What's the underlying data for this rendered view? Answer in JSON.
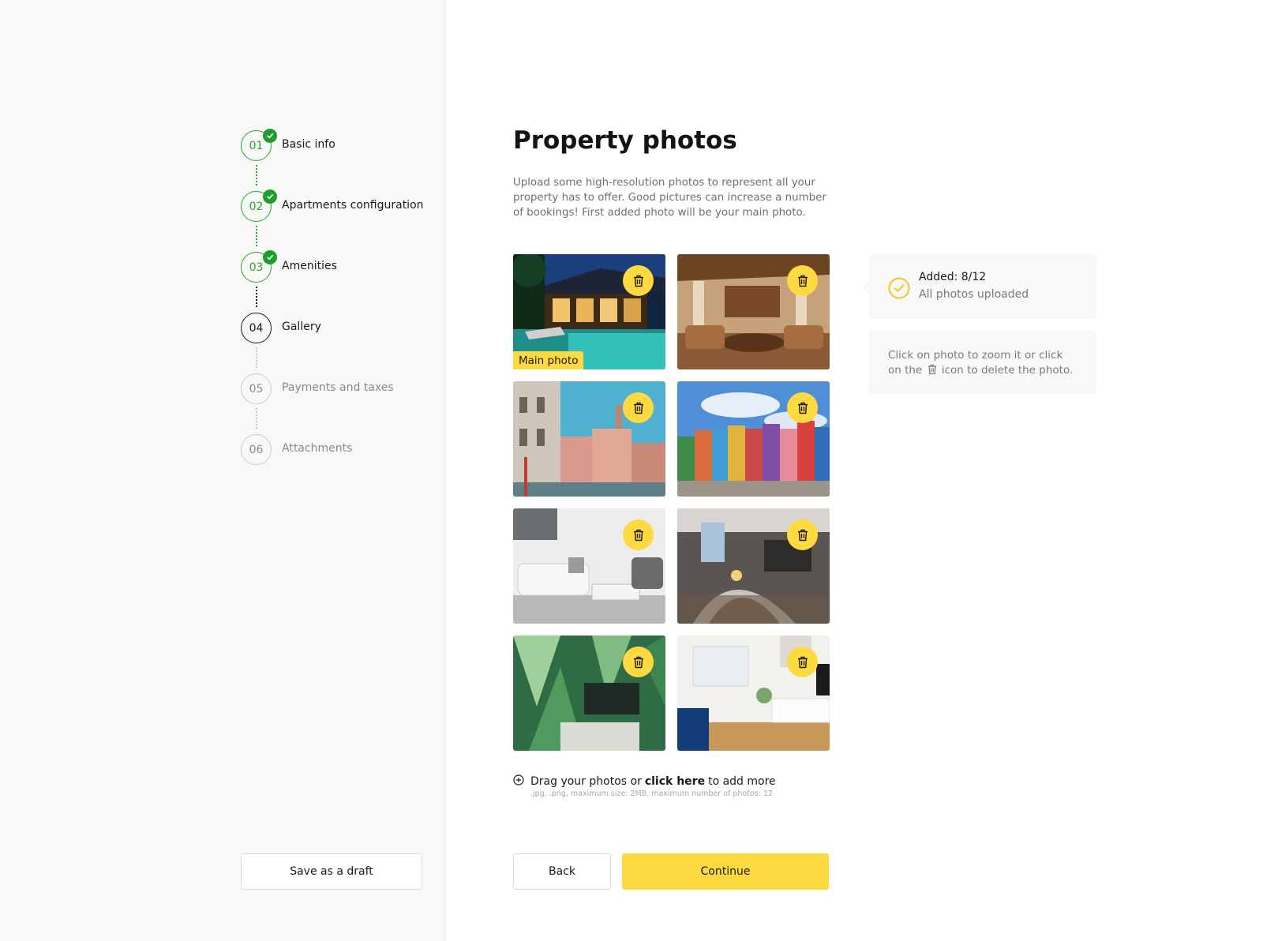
{
  "steps": [
    {
      "number": "01",
      "label": "Basic info",
      "state": "done"
    },
    {
      "number": "02",
      "label": "Apartments configuration",
      "state": "done"
    },
    {
      "number": "03",
      "label": "Amenities",
      "state": "done"
    },
    {
      "number": "04",
      "label": "Gallery",
      "state": "current"
    },
    {
      "number": "05",
      "label": "Payments and taxes",
      "state": "pending"
    },
    {
      "number": "06",
      "label": "Attachments",
      "state": "pending"
    }
  ],
  "sidebar": {
    "draft_label": "Save as a draft"
  },
  "page": {
    "title": "Property photos",
    "description": "Upload some high-resolution photos to represent all your property has to offer. Good pictures can increase a number of bookings! First added photo will be your main photo."
  },
  "photos": {
    "main_tag": "Main photo",
    "items": [
      {
        "subject": "villa with pool at night"
      },
      {
        "subject": "wood-paneled living room"
      },
      {
        "subject": "pink venetian facades"
      },
      {
        "subject": "colorful market square houses"
      },
      {
        "subject": "white sofa living room"
      },
      {
        "subject": "loft with staircase"
      },
      {
        "subject": "tropical leaf wallpaper room"
      },
      {
        "subject": "bright room with blue sofa"
      }
    ]
  },
  "status": {
    "added_label": "Added: 8/12",
    "uploaded_label": "All photos uploaded"
  },
  "hint": {
    "before_icon": "Click on photo to zoom it or click on the",
    "after_icon": "icon to delete the photo."
  },
  "uploader": {
    "prefix": "Drag your photos or",
    "link": "click here",
    "suffix": "to add more",
    "rules": ".jpg, .png, maximum size: 2MB, maximum number of photos: 12"
  },
  "footer": {
    "back_label": "Back",
    "continue_label": "Continue"
  },
  "colors": {
    "accent": "#ffd940",
    "success": "#2ba52b",
    "muted": "#7a7a7a"
  },
  "icons": {
    "delete": "trash-icon",
    "completed": "check-icon",
    "add": "plus-circle-icon",
    "status": "check-circle-icon"
  }
}
